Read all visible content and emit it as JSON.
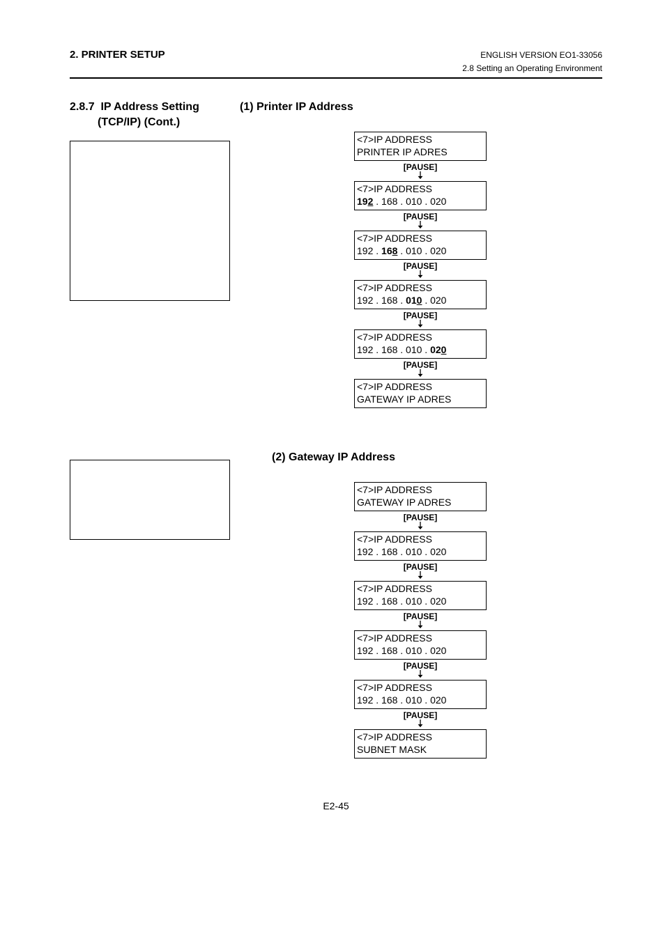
{
  "header": {
    "left": "2. PRINTER SETUP",
    "right": "ENGLISH VERSION EO1-33056",
    "sub": "2.8 Setting an Operating Environment"
  },
  "section": {
    "number": "2.8.7",
    "title_line1": "IP Address Setting",
    "title_line2": "(TCP/IP) (Cont.)"
  },
  "sub1": {
    "heading": "(1)  Printer IP Address",
    "boxes": [
      [
        "<7>IP ADDRESS",
        "PRINTER IP ADRES"
      ],
      [
        "<7>IP ADDRESS",
        "__B192__ . 168 . 010 . 020"
      ],
      [
        "<7>IP ADDRESS",
        "192 . __B168__ . 010 . 020"
      ],
      [
        "<7>IP ADDRESS",
        "192 . 168 . __B010__ . 020"
      ],
      [
        "<7>IP ADDRESS",
        "192 . 168 . 010 . __B020__"
      ],
      [
        "<7>IP ADDRESS",
        "GATEWAY IP ADRES"
      ]
    ],
    "pause": "[PAUSE]"
  },
  "sub2": {
    "heading": "(2)  Gateway IP Address",
    "boxes": [
      [
        "<7>IP ADDRESS",
        "GATEWAY IP ADRES"
      ],
      [
        "<7>IP ADDRESS",
        "192 . 168 . 010 . 020"
      ],
      [
        "<7>IP ADDRESS",
        "192 . 168 . 010 . 020"
      ],
      [
        "<7>IP ADDRESS",
        "192 . 168 . 010 . 020"
      ],
      [
        "<7>IP ADDRESS",
        "192 . 168 . 010 . 020"
      ],
      [
        "<7>IP ADDRESS",
        "SUBNET MASK"
      ]
    ],
    "pause": "[PAUSE]"
  },
  "footer": "E2-45"
}
